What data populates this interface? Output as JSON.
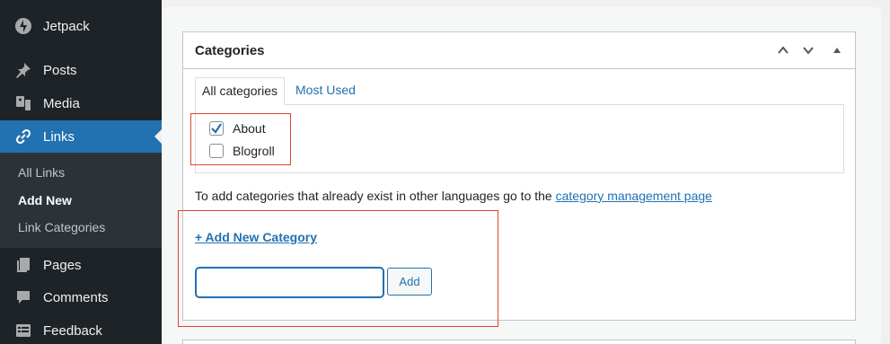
{
  "sidebar": {
    "items": [
      {
        "label": "Jetpack",
        "icon": "jetpack-icon"
      },
      {
        "label": "Posts",
        "icon": "pin-icon"
      },
      {
        "label": "Media",
        "icon": "media-icon"
      },
      {
        "label": "Links",
        "icon": "link-icon",
        "current": true
      },
      {
        "label": "Pages",
        "icon": "pages-icon"
      },
      {
        "label": "Comments",
        "icon": "comment-icon"
      },
      {
        "label": "Feedback",
        "icon": "feedback-icon"
      }
    ],
    "submenu": [
      {
        "label": "All Links"
      },
      {
        "label": "Add New",
        "current": true
      },
      {
        "label": "Link Categories"
      }
    ]
  },
  "postbox": {
    "title": "Categories",
    "tabs": [
      {
        "label": "All categories",
        "active": true
      },
      {
        "label": "Most Used",
        "active": false
      }
    ],
    "categories": [
      {
        "label": "About",
        "checked": true
      },
      {
        "label": "Blogroll",
        "checked": false
      }
    ],
    "info_text": "To add categories that already exist in other languages go to the ",
    "info_link": "category management page",
    "add_new_link": "+ Add New Category",
    "new_category_value": "",
    "add_button": "Add"
  },
  "colors": {
    "accent": "#2271b1",
    "sidebar_bg": "#1d2327",
    "highlight": "#e0442e"
  }
}
